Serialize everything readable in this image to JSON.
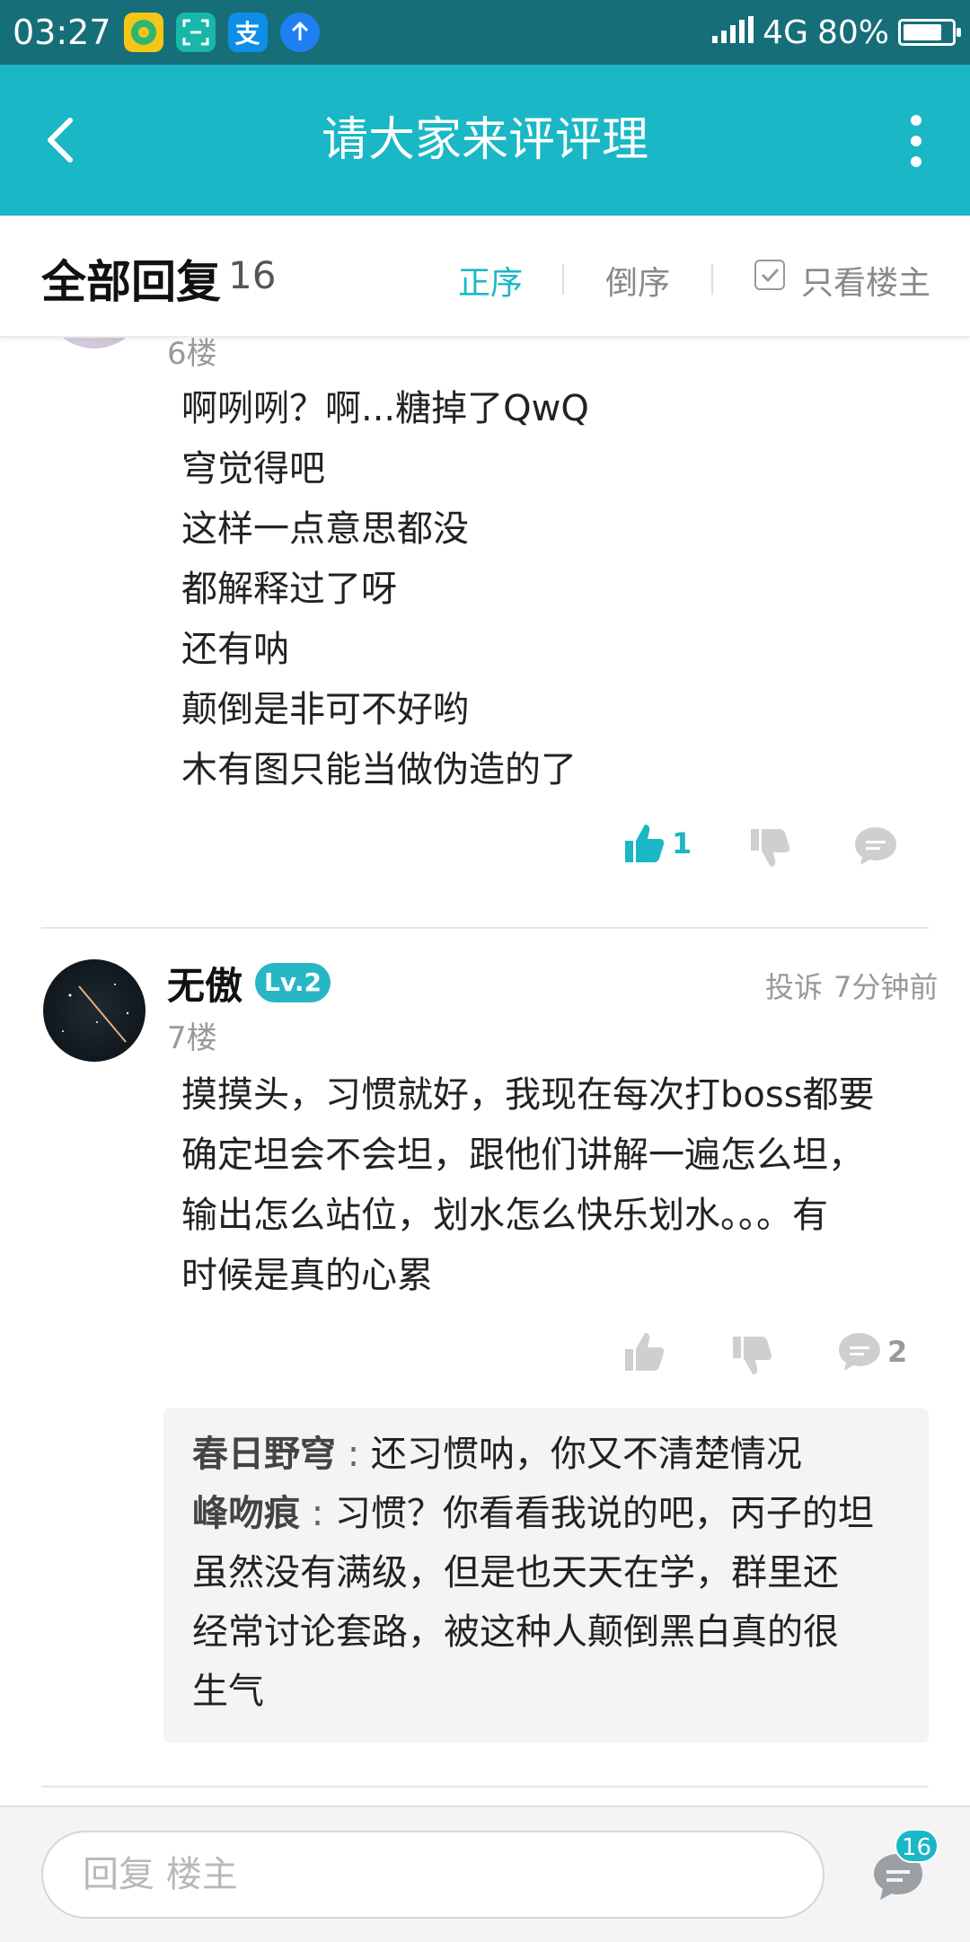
{
  "status_bar": {
    "time": "03:27",
    "network": "4G",
    "battery": "80%",
    "battery_level": 0.8
  },
  "header": {
    "title": "请大家来评评理"
  },
  "sort_bar": {
    "label": "全部回复",
    "count": "16",
    "asc": "正序",
    "desc": "倒序",
    "owner_only": "只看楼主"
  },
  "posts": [
    {
      "floor": "6楼",
      "lines": [
        "啊咧咧？啊...糖掉了QwQ",
        "穹觉得吧",
        "这样一点意思都没",
        "都解释过了呀",
        "还有呐",
        "颠倒是非可不好哟",
        "木有图只能当做伪造的了"
      ],
      "likes": "1"
    },
    {
      "username": "无傲",
      "level": "Lv.2",
      "report": "投诉",
      "time": "7分钟前",
      "floor": "7楼",
      "lines": [
        "摸摸头，习惯就好，我现在每次打boss都要",
        "确定坦会不会坦，跟他们讲解一遍怎么坦，",
        "输出怎么站位，划水怎么快乐划水。。。有",
        "时候是真的心累"
      ],
      "comment_count": "2",
      "replies": [
        {
          "author": "春日野穹",
          "text": "还习惯呐，你又不清楚情况"
        },
        {
          "author": "峰吻痕",
          "text": "习惯？你看看我说的吧，丙子的坦",
          "cont": [
            "虽然没有满级，但是也天天在学，群里还",
            "经常讨论套路，被这种人颠倒黑白真的很",
            "生气"
          ]
        }
      ]
    }
  ],
  "bottom_bar": {
    "placeholder": "回复  楼主",
    "badge": "16"
  }
}
